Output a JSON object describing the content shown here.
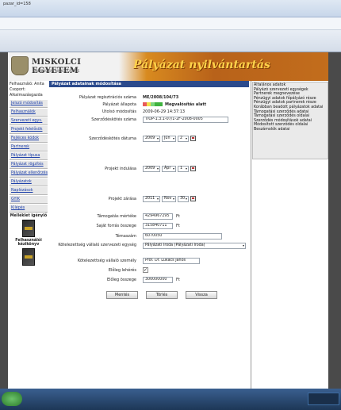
{
  "browser": {
    "title": "pazar_id=158"
  },
  "header": {
    "university": "MISKOLCI EGYETEM",
    "university_sub": "UNIVERSITAS MISKOLCIENSIS",
    "app_title": "Pályázat nyilvántartás"
  },
  "sidebar": {
    "user_label": "Felhasználó: Anita",
    "group_label": "Csoport:",
    "group_value": "Alkalmazásgazda",
    "items": [
      {
        "label": "Jelszó módosítás"
      },
      {
        "label": "Felhasználók"
      },
      {
        "label": "Szervezeti egys."
      },
      {
        "label": "Projekt felelősök"
      },
      {
        "label": "Fejléces kódok"
      },
      {
        "label": "Partnerek"
      },
      {
        "label": "Pályázat típusa"
      },
      {
        "label": "Pályázat rögzítés"
      },
      {
        "label": "Pályázat ellenőrzés"
      },
      {
        "label": "Pályázatok"
      },
      {
        "label": "Naplózások"
      },
      {
        "label": "GYIK"
      },
      {
        "label": "Kilépés"
      }
    ],
    "box1_label": "Melléklet igénylő",
    "box2_label": "Felhasználói kézikönyv"
  },
  "form": {
    "header": "Pályázat adatainak módosítása",
    "reg_label": "Pályázat regisztrációs száma",
    "reg_value": "ME/2008/104/73",
    "state_label": "Pályázat állapota",
    "state_value": "Megvalósítás alatt",
    "state_colors": [
      "#e85a5a",
      "#f0e14a",
      "#7cd67c",
      "#3fb33f",
      "#3fb33f"
    ],
    "lastmod_label": "Utolsó módosítás",
    "lastmod_value": "2009-06-29 14:37:13",
    "contract_no_label": "Szerződéskötés száma",
    "contract_no_value": "TIOP-1.3.1-07/1-2F-2008-0005",
    "contract_date_label": "Szerződéskötés dátuma",
    "contract_date": {
      "year": "2009",
      "month": "Jún",
      "day": "2"
    },
    "project_start_label": "Projekt indulása",
    "project_start": {
      "year": "2009",
      "month": "Ápr",
      "day": "1"
    },
    "project_end_label": "Projekt zárása",
    "project_end": {
      "year": "2011",
      "month": "Nov",
      "day": "30"
    },
    "support_label": "Támogatás mértéke",
    "support_value": "4294967295",
    "own_label": "Saját forrás összege",
    "own_value": "315840711",
    "currency": "Ft",
    "topic_label": "Témaszám",
    "topic_value": "6070050",
    "org_label": "Kötelezettség vállaló szervezeti egység",
    "org_value": "Pályázati Iroda (Pályázati Iroda)",
    "person_label": "Kötelezettség vállaló személy",
    "person_value": "Prof. Dr. Lukács János",
    "advance_label": "Előleg lehérés",
    "advance_checked": "✓",
    "advance_amount_label": "Előleg összege",
    "advance_amount_value": "300000000",
    "buttons": {
      "save": "Mentés",
      "delete": "Törlés",
      "back": "Vissza"
    }
  },
  "rightpanel": {
    "items": [
      "Általános adatok",
      "Pályázó szervezeti egységek",
      "Partnerek megnevezése",
      "Pénzügyi adatok főpályázó része",
      "Pénzügyi adatok partnerek része",
      "Korábban beadott pályázatok adatai",
      "Támogatási szerződés adatai",
      "Támogatási szerződés oldalai",
      "Szerződés módosítások adatai",
      "Módosított szerződés oldalai",
      "Beszámolók adatai"
    ]
  },
  "taskbar": {
    "tray_text": ""
  }
}
